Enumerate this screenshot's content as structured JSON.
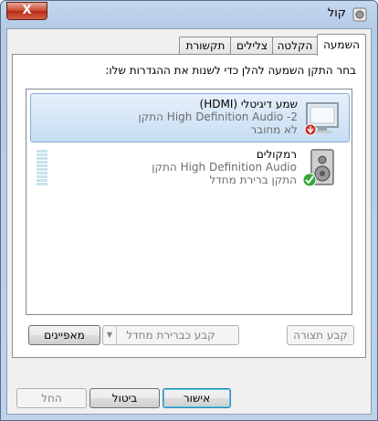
{
  "window": {
    "title": "קול",
    "close_label": "X"
  },
  "tabs": [
    {
      "label": "השמעה"
    },
    {
      "label": "הקלטה"
    },
    {
      "label": "צלילים"
    },
    {
      "label": "תקשורת"
    }
  ],
  "playback": {
    "instruction": "בחר התקן השמעה להלן כדי לשנות את ההגדרות שלו:",
    "devices": [
      {
        "name": "שמע דיגיטלי (HDMI)",
        "line1": "High Definition Audio -2 התקן",
        "status": "לא מחובר",
        "icon": "monitor-speaker-icon",
        "status_icon": "disconnected-icon",
        "selected": true
      },
      {
        "name": "רמקולים",
        "line1": "High Definition Audio התקן",
        "status": "התקן ברירת מחדל",
        "icon": "speaker-icon",
        "status_icon": "default-check-icon",
        "selected": false
      }
    ]
  },
  "panel_buttons": {
    "configure": "קבע תצורה",
    "set_default": "קבע כברירת מחדל",
    "properties": "מאפיינים"
  },
  "dialog_buttons": {
    "ok": "אישור",
    "cancel": "ביטול",
    "apply": "החל"
  },
  "colors": {
    "selection": "#c7ddf3",
    "check_green": "#2fa838",
    "disconnected_red": "#c8301e"
  }
}
